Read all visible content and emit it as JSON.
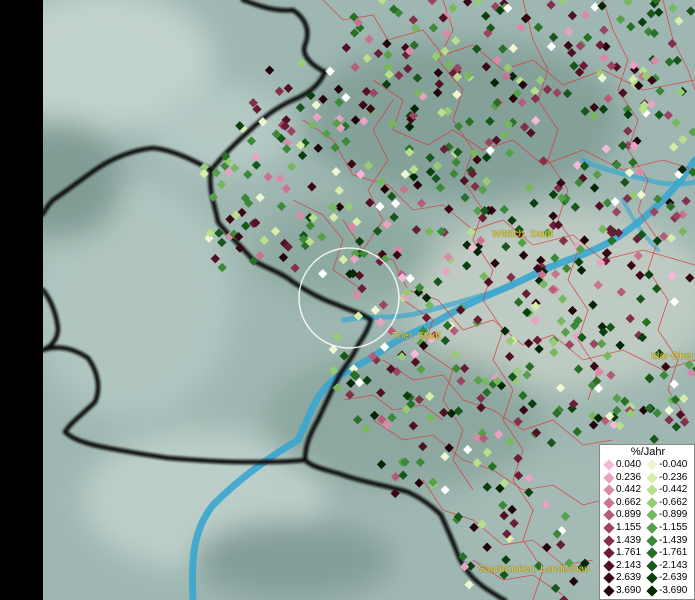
{
  "legend": {
    "title": "%/Jahr",
    "positive": [
      {
        "label": "0.040",
        "color": "#f4b9d8"
      },
      {
        "label": "0.236",
        "color": "#e9a2c2"
      },
      {
        "label": "0.442",
        "color": "#d98aa8"
      },
      {
        "label": "0.662",
        "color": "#c87391"
      },
      {
        "label": "0.899",
        "color": "#b45c79"
      },
      {
        "label": "1.155",
        "color": "#9c4561"
      },
      {
        "label": "1.439",
        "color": "#83304b"
      },
      {
        "label": "1.761",
        "color": "#6a1e36"
      },
      {
        "label": "2.143",
        "color": "#521024"
      },
      {
        "label": "2.639",
        "color": "#3a0715"
      },
      {
        "label": "3.690",
        "color": "#22030a"
      }
    ],
    "negative": [
      {
        "label": "-0.040",
        "color": "#eef7cf"
      },
      {
        "label": "-0.236",
        "color": "#d6eeaa"
      },
      {
        "label": "-0.442",
        "color": "#b9df8c"
      },
      {
        "label": "-0.662",
        "color": "#98cc74"
      },
      {
        "label": "-0.899",
        "color": "#77b75e"
      },
      {
        "label": "-1.155",
        "color": "#57a04a"
      },
      {
        "label": "-1.439",
        "color": "#3d8838"
      },
      {
        "label": "-1.761",
        "color": "#286f28"
      },
      {
        "label": "-2.143",
        "color": "#17571a"
      },
      {
        "label": "-2.639",
        "color": "#0a3f0e"
      },
      {
        "label": "-3.690",
        "color": "#032605"
      }
    ]
  },
  "places": [
    {
      "name": "Wittlich, Stadt"
    },
    {
      "name": "Trier, Stadt"
    },
    {
      "name": "Idar-Ober"
    },
    {
      "name": "Saarbrücken, Landeshau"
    }
  ],
  "colors": {
    "terrain": "#9fb7b2",
    "terrain_light": "#c9d8d4",
    "river": "#3aa6cf",
    "border_major": "#0a0a0a",
    "border_minor": "#d83a3a"
  }
}
